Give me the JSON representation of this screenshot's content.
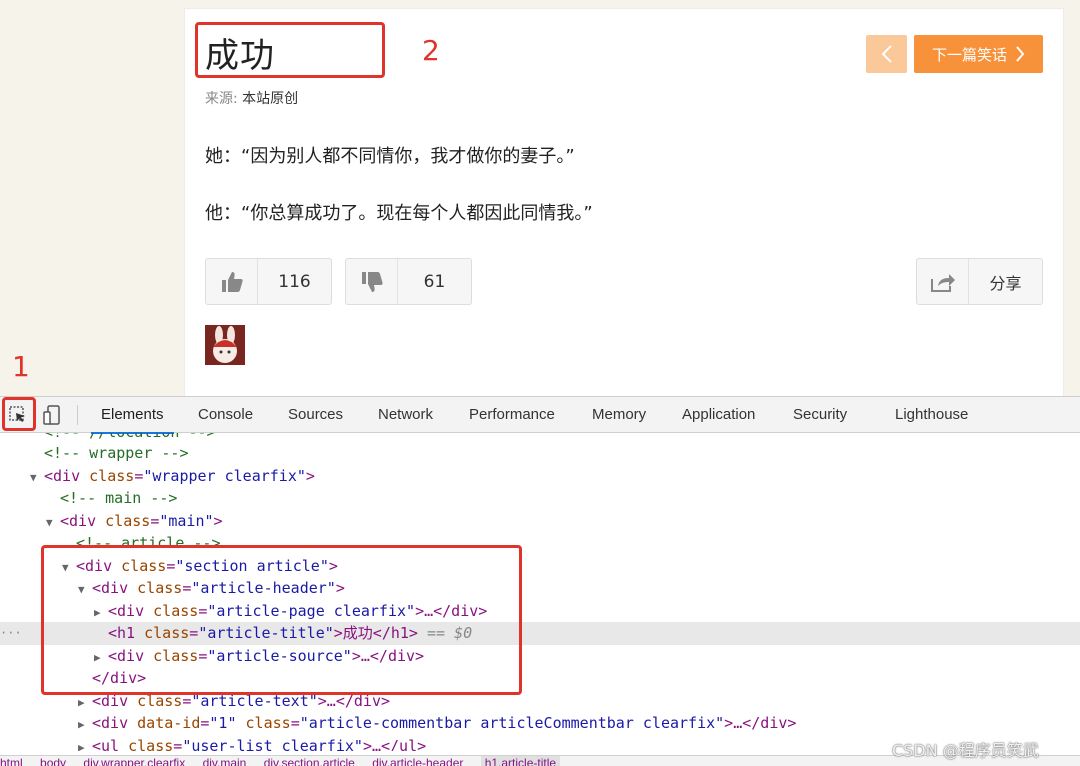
{
  "article": {
    "title": "成功",
    "source_label": "来源:",
    "source_value": "本站原创",
    "paragraphs": [
      "她：“因为别人都不同情你，我才做你的妻子。”",
      "他：“你总算成功了。现在每个人都因此同情我。”"
    ],
    "next_label": "下一篇笑话",
    "likes": "116",
    "dislikes": "61",
    "share_label": "分享"
  },
  "annotations": {
    "label_1": "1",
    "label_2": "2"
  },
  "devtools": {
    "tabs": [
      "Elements",
      "Console",
      "Sources",
      "Network",
      "Performance",
      "Memory",
      "Application",
      "Security",
      "Lighthouse"
    ],
    "active_tab": "Elements",
    "lines": {
      "l0": "<!-- //location -->",
      "l1": "<!-- wrapper -->",
      "l2_tag": "<div ",
      "l2_attr": "class",
      "l2_val": "\"wrapper clearfix\"",
      "l2_end": ">",
      "l3": "<!-- main -->",
      "l4_tag": "<div ",
      "l4_attr": "class",
      "l4_val": "\"main\"",
      "l4_end": ">",
      "l5": "<!-- article -->",
      "l6_tag": "<div ",
      "l6_attr": "class",
      "l6_val": "\"section article\"",
      "l6_end": ">",
      "l7_tag": "<div ",
      "l7_attr": "class",
      "l7_val": "\"article-header\"",
      "l7_end": ">",
      "l8_tag": "<div ",
      "l8_attr": "class",
      "l8_val": "\"article-page clearfix\"",
      "l8_end": ">…</div>",
      "l9_tag": "<h1 ",
      "l9_attr": "class",
      "l9_val": "\"article-title\"",
      "l9_end": ">成功</h1>",
      "l9_eq": " == $0",
      "l10_tag": "<div ",
      "l10_attr": "class",
      "l10_val": "\"article-source\"",
      "l10_end": ">…</div>",
      "l11": "</div>",
      "l12_tag": "<div ",
      "l12_attr": "class",
      "l12_val": "\"article-text\"",
      "l12_end": ">…</div>",
      "l13_tag": "<div ",
      "l13_attr1": "data-id",
      "l13_val1": "\"1\"",
      "l13_attr2": " class",
      "l13_val2": "\"article-commentbar articleCommentbar clearfix\"",
      "l13_end": ">…</div>",
      "l14_tag": "<ul ",
      "l14_attr": "class",
      "l14_val": "\"user-list clearfix\"",
      "l14_end": ">…</ul>"
    },
    "breadcrumb": [
      "html",
      "body",
      "div.wrapper.clearfix",
      "div.main",
      "div.section.article",
      "div.article-header",
      "h1.article-title"
    ]
  },
  "watermark": "CSDN @程序员笑武",
  "colors": {
    "accent_orange": "#f7923a",
    "annotation_red": "#e0342b",
    "devtools_tab_active": "#1a73e8"
  }
}
